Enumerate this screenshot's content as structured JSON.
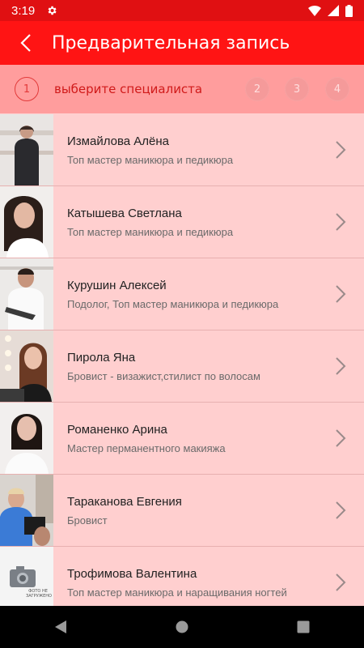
{
  "status": {
    "time": "3:19"
  },
  "header": {
    "title": "Предварительная запись"
  },
  "stepper": {
    "active_number": "1",
    "active_label": "выберите специалиста",
    "steps": [
      "2",
      "3",
      "4"
    ]
  },
  "specialists": [
    {
      "name": "Измайлова Алёна",
      "role": "Топ мастер маникюра и педикюра"
    },
    {
      "name": "Катышева Светлана",
      "role": "Топ мастер маникюра и педикюра"
    },
    {
      "name": "Курушин Алексей",
      "role": "Подолог, Топ мастер маникюра и педикюра"
    },
    {
      "name": "Пирола Яна",
      "role": "Бровист - визажист,стилист по волосам"
    },
    {
      "name": "Романенко Арина",
      "role": "Мастер перманентного макияжа"
    },
    {
      "name": "Тараканова Евгения",
      "role": "Бровист"
    },
    {
      "name": "Трофимова Валентина",
      "role": "Топ мастер маникюра и наращивания ногтей"
    }
  ],
  "placeholder_photo_text": "ФОТО НЕ ЗАГРУЖЕНО",
  "colors": {
    "statusbar": "#e01012",
    "appbar": "#ff1414",
    "stepper": "#ff9d9d",
    "list_bg": "#ffcfcf"
  }
}
